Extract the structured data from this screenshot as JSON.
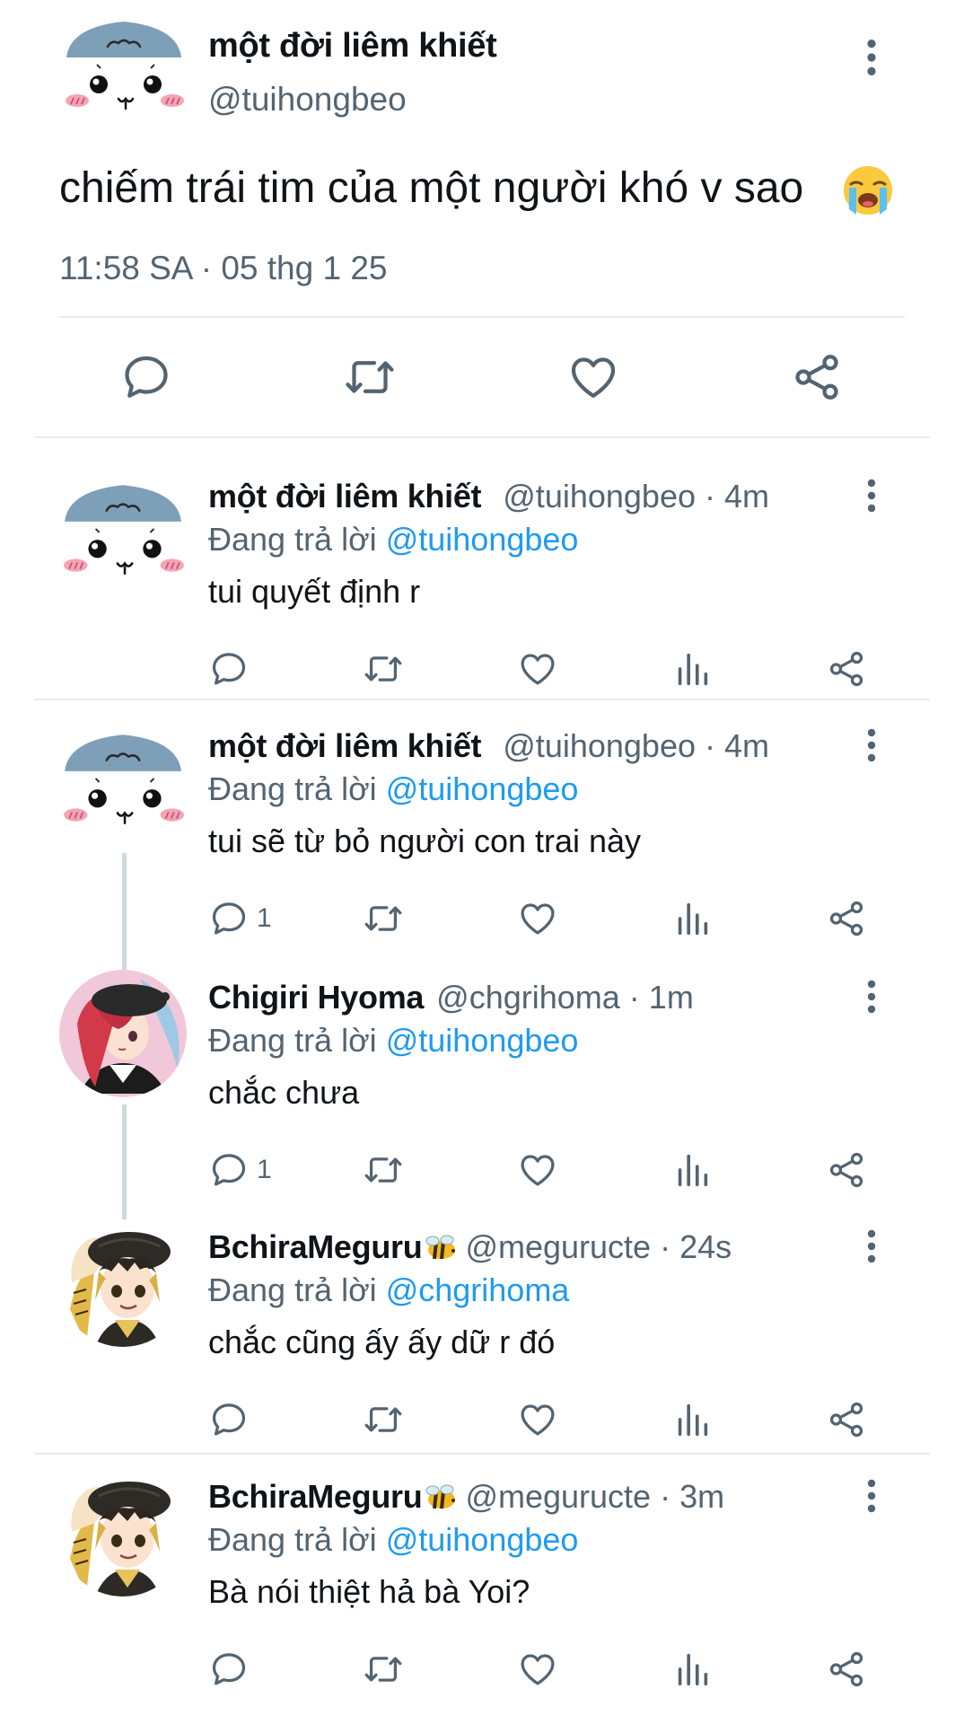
{
  "main_tweet": {
    "author_name": "một đời liêm khiết",
    "author_handle": "@tuihongbeo",
    "text": "chiếm trái tim của một người khó v sao",
    "emoji": "loudly-crying-face",
    "timestamp": "11:58 SA · 05 thg 1 25",
    "actions": [
      "reply-icon",
      "retweet-icon",
      "like-icon",
      "share-icon"
    ]
  },
  "replies": [
    {
      "name": "một đời liêm khiết",
      "handle": "@tuihongbeo",
      "time": "4m",
      "replying_label": "Đang trả lời",
      "replying_to": "@tuihongbeo",
      "text": "tui quyết định r",
      "reply_count": "",
      "avatar": "hat-face-avatar"
    },
    {
      "name": "một đời liêm khiết",
      "handle": "@tuihongbeo",
      "time": "4m",
      "replying_label": "Đang trả lời",
      "replying_to": "@tuihongbeo",
      "text": "tui sẽ từ bỏ người con trai này",
      "reply_count": "1",
      "avatar": "hat-face-avatar"
    },
    {
      "name": "Chigiri Hyoma",
      "handle": "@chgrihoma",
      "time": "1m",
      "replying_label": "Đang trả lời",
      "replying_to": "@tuihongbeo",
      "text": "chắc chưa",
      "reply_count": "1",
      "avatar": "red-hair-anime-avatar"
    },
    {
      "name": "BchiraMeguru",
      "handle": "@meguructe",
      "time": "24s",
      "replying_label": "Đang trả lời",
      "replying_to": "@chgrihoma",
      "text": "chắc cũng ấy ấy dữ r đó",
      "reply_count": "",
      "avatar": "dark-hair-anime-avatar",
      "badge_emoji": "bee-emoji"
    },
    {
      "name": "BchiraMeguru",
      "handle": "@meguructe",
      "time": "3m",
      "replying_label": "Đang trả lời",
      "replying_to": "@tuihongbeo",
      "text": "Bà nói thiệt hả bà Yoi?",
      "reply_count": "",
      "avatar": "dark-hair-anime-avatar",
      "badge_emoji": "bee-emoji"
    }
  ],
  "separator": " · ",
  "colors": {
    "text_primary": "#0f1419",
    "text_secondary": "#536471",
    "mention": "#1d9bf0",
    "divider": "#e6ecf0",
    "thread_line": "#cfd9de",
    "avatar_hat": "#7e9fb8",
    "blush": "#f5a3b5"
  }
}
